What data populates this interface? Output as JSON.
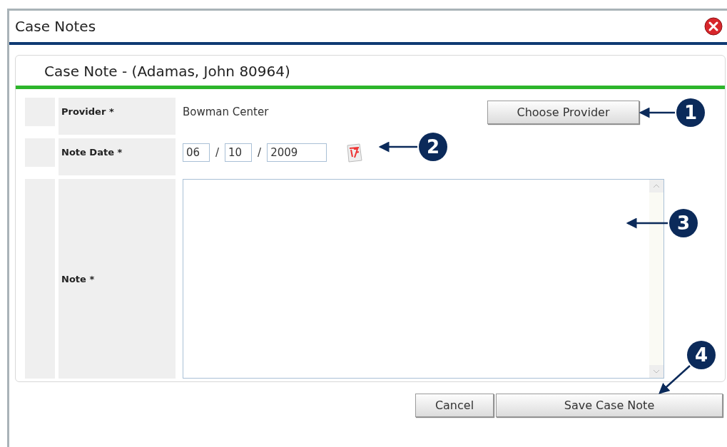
{
  "window": {
    "title": "Case Notes"
  },
  "panel": {
    "title": "Case Note - (Adamas, John 80964)"
  },
  "form": {
    "provider": {
      "label": "Provider",
      "required_mark": "*",
      "value": "Bowman Center",
      "button": "Choose Provider"
    },
    "note_date": {
      "label": "Note Date",
      "required_mark": "*",
      "month": "06",
      "separator_1": "/",
      "day": "10",
      "separator_2": "/",
      "year": "2009"
    },
    "note": {
      "label": "Note",
      "required_mark": "*"
    }
  },
  "buttons": [
    {
      "label": "Cancel",
      "kind": "cancel"
    },
    {
      "label": "Save Case Note",
      "kind": "save"
    }
  ],
  "callouts": [
    {
      "number": "1"
    },
    {
      "number": "2"
    },
    {
      "number": "3"
    },
    {
      "number": "4"
    }
  ]
}
